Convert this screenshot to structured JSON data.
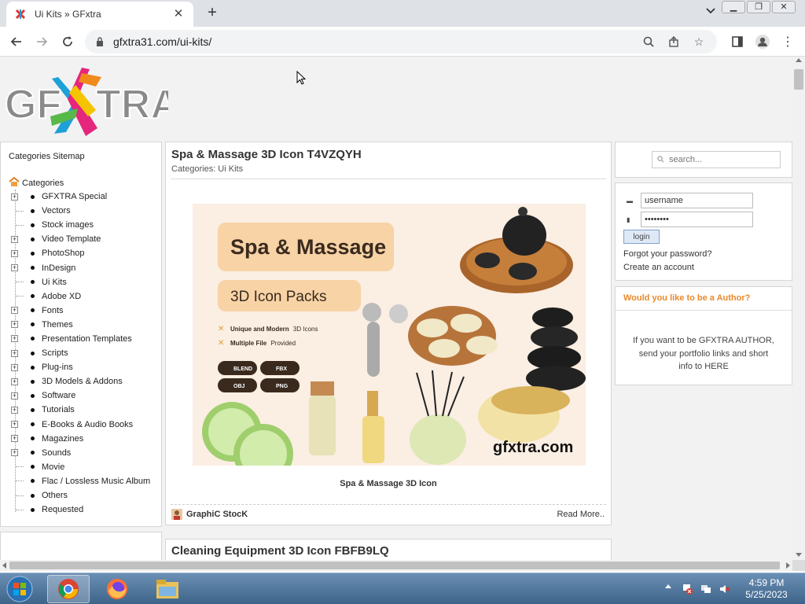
{
  "browser": {
    "tab_title": "Ui Kits » GFxtra",
    "url": "gfxtra31.com/ui-kits/"
  },
  "sidebar": {
    "sitemap_label": "Categories Sitemap",
    "root_label": "Categories",
    "items": [
      {
        "label": "GFXTRA Special",
        "expandable": true
      },
      {
        "label": "Vectors",
        "expandable": false
      },
      {
        "label": "Stock images",
        "expandable": false
      },
      {
        "label": "Video Template",
        "expandable": true
      },
      {
        "label": "PhotoShop",
        "expandable": true
      },
      {
        "label": "InDesign",
        "expandable": true
      },
      {
        "label": "Ui Kits",
        "expandable": false
      },
      {
        "label": "Adobe XD",
        "expandable": false
      },
      {
        "label": "Fonts",
        "expandable": true
      },
      {
        "label": "Themes",
        "expandable": true
      },
      {
        "label": "Presentation Templates",
        "expandable": true
      },
      {
        "label": "Scripts",
        "expandable": true
      },
      {
        "label": "Plug-ins",
        "expandable": true
      },
      {
        "label": "3D Models & Addons",
        "expandable": true
      },
      {
        "label": "Software",
        "expandable": true
      },
      {
        "label": "Tutorials",
        "expandable": true
      },
      {
        "label": "E-Books & Audio Books",
        "expandable": true
      },
      {
        "label": "Magazines",
        "expandable": true
      },
      {
        "label": "Sounds",
        "expandable": true
      },
      {
        "label": "Movie",
        "expandable": false
      },
      {
        "label": "Flac / Lossless Music Album",
        "expandable": false
      },
      {
        "label": "Others",
        "expandable": false
      },
      {
        "label": "Requested",
        "expandable": false
      }
    ]
  },
  "post": {
    "title": "Spa & Massage 3D Icon T4VZQYH",
    "categories": "Categories: Ui Kits",
    "caption": "Spa & Massage 3D Icon",
    "author": "GraphiC StocK",
    "read_more": "Read More..",
    "image": {
      "headline": "Spa & Massage",
      "subheadline": "3D Icon Packs",
      "bullet1_a": "Unique and Modern",
      "bullet1_b": "3D Icons",
      "bullet2_a": "Multiple File",
      "bullet2_b": "Provided",
      "badges": [
        "BLEND",
        "FBX",
        "OBJ",
        "PNG"
      ],
      "watermark": "gfxtra.com"
    }
  },
  "post2": {
    "title": "Cleaning Equipment 3D Icon FBFB9LQ"
  },
  "search": {
    "placeholder": "search..."
  },
  "login": {
    "username": "username",
    "password": "••••••••",
    "button": "login",
    "forgot": "Forgot your password?",
    "create": "Create an account"
  },
  "author_box": {
    "heading": "Would you like to be a Author?",
    "text": "If you want to be GFXTRA AUTHOR, send your portfolio links and short info to HERE"
  },
  "taskbar": {
    "time": "4:59 PM",
    "date": "5/25/2023"
  },
  "colors": {
    "accent_orange": "#e8892a",
    "tab_bar": "#dee1e6"
  }
}
